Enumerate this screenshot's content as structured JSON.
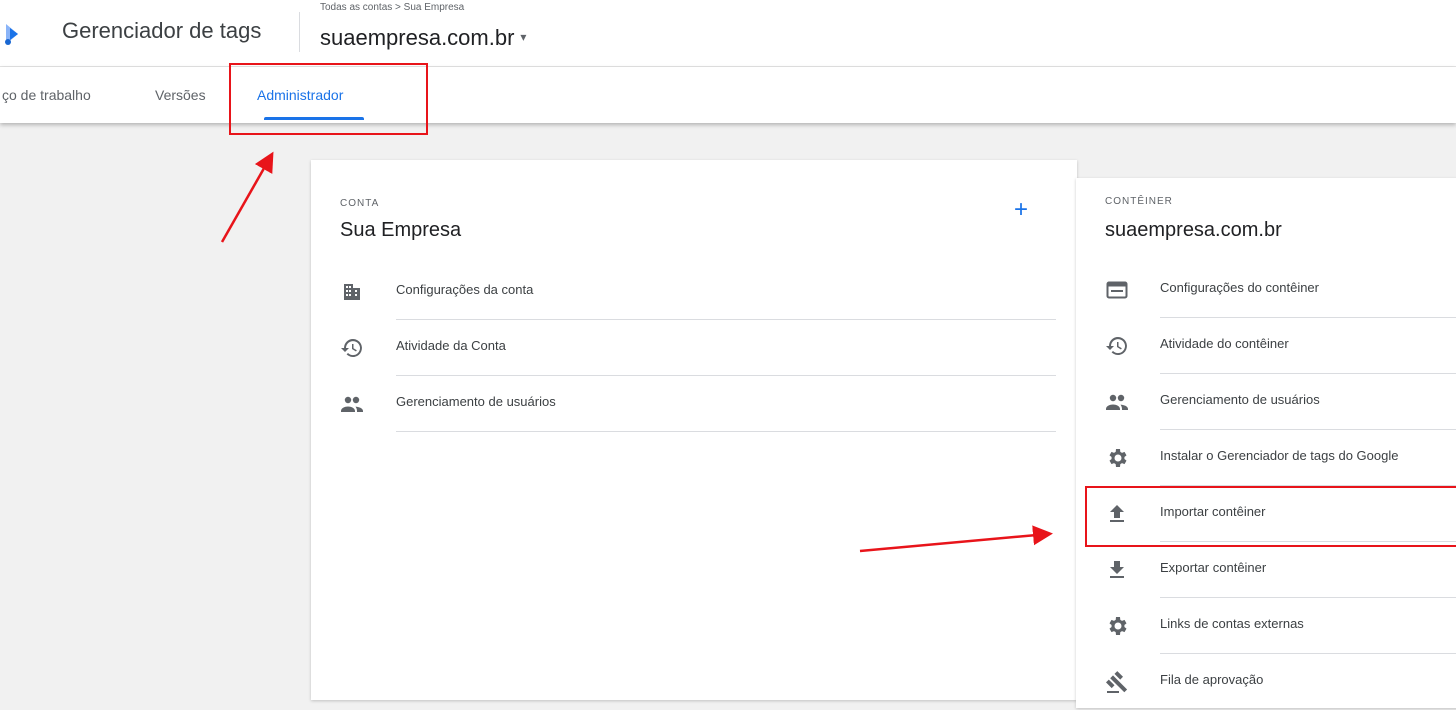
{
  "header": {
    "app_title": "Gerenciador de tags",
    "breadcrumb": "Todas as contas > Sua Empresa",
    "container_name": "suaempresa.com.br",
    "caret": "▾"
  },
  "tabs": [
    {
      "label": "ço de trabalho"
    },
    {
      "label": "Versões"
    },
    {
      "label": "Administrador",
      "active": true
    }
  ],
  "account_card": {
    "label": "CONTA",
    "title": "Sua Empresa",
    "add_symbol": "+",
    "items": [
      {
        "label": "Configurações da conta",
        "icon": "building-icon"
      },
      {
        "label": "Atividade da Conta",
        "icon": "history-icon"
      },
      {
        "label": "Gerenciamento de usuários",
        "icon": "people-icon"
      }
    ]
  },
  "container_card": {
    "label": "CONTÊINER",
    "title": "suaempresa.com.br",
    "items": [
      {
        "label": "Configurações do contêiner",
        "icon": "window-icon"
      },
      {
        "label": "Atividade do contêiner",
        "icon": "history-icon"
      },
      {
        "label": "Gerenciamento de usuários",
        "icon": "people-icon"
      },
      {
        "label": "Instalar o Gerenciador de tags do Google",
        "icon": "gear-icon"
      },
      {
        "label": "Importar contêiner",
        "icon": "upload-icon"
      },
      {
        "label": "Exportar contêiner",
        "icon": "download-icon"
      },
      {
        "label": "Links de contas externas",
        "icon": "gear-icon"
      },
      {
        "label": "Fila de aprovação",
        "icon": "gavel-icon"
      }
    ]
  },
  "colors": {
    "accent": "#1a73e8",
    "annotation": "#e8141a",
    "icon": "#5f6368"
  }
}
